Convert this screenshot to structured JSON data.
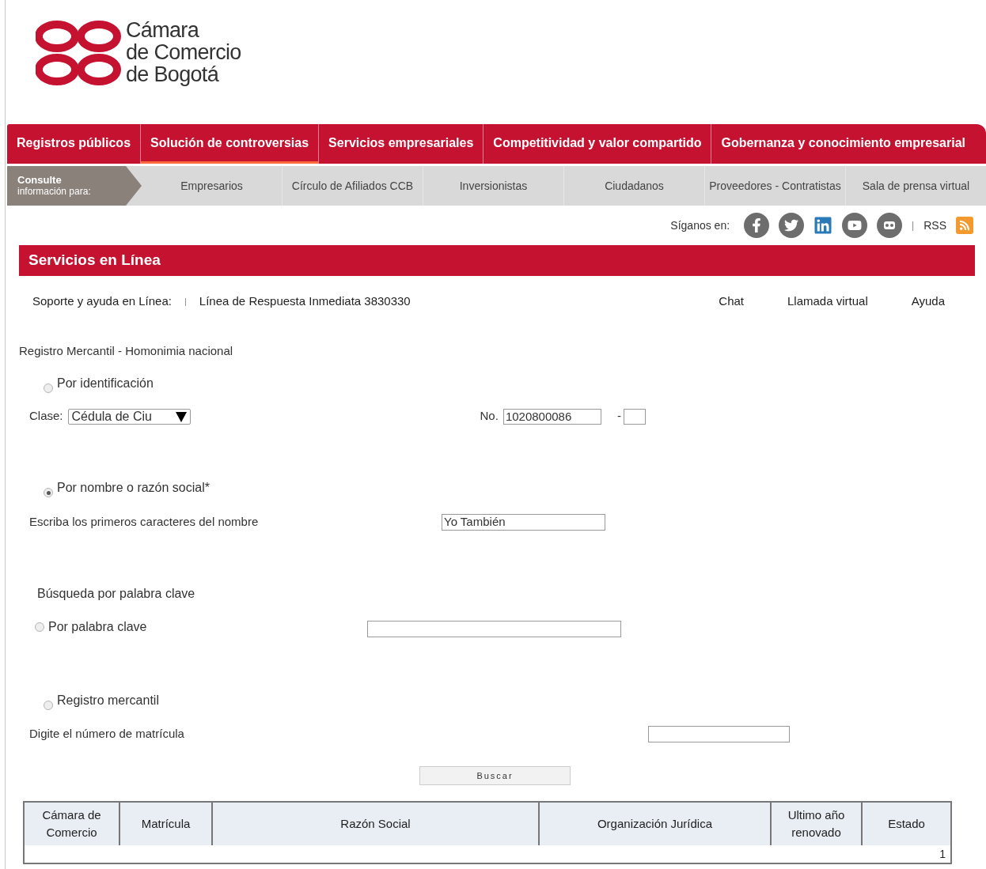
{
  "logo": {
    "lines": [
      "Cámara",
      "de Comercio",
      "de Bogotá"
    ]
  },
  "main_nav": [
    {
      "label": "Registros públicos",
      "selected": false
    },
    {
      "label": "Solución de controversias",
      "selected": true
    },
    {
      "label": "Servicios empresariales",
      "selected": false
    },
    {
      "label": "Competitividad y valor compartido",
      "selected": false
    },
    {
      "label": "Gobernanza y conocimiento empresarial",
      "selected": false
    }
  ],
  "sub_nav": {
    "title": "Consulte",
    "subtitle": "información para:",
    "items": [
      "Empresarios",
      "Círculo de Afiliados CCB",
      "Inversionistas",
      "Ciudadanos",
      "Proveedores - Contratistas",
      "Sala de prensa virtual"
    ]
  },
  "social": {
    "label": "Síganos en:",
    "separator": "|",
    "rss": "RSS"
  },
  "section_title": "Servicios en Línea",
  "support": {
    "label": "Soporte y ayuda en Línea:",
    "separator": "|",
    "line": "Línea de Respuesta Inmediata 3830330",
    "links": [
      "Chat",
      "Llamada virtual",
      "Ayuda"
    ]
  },
  "form": {
    "title": "Registro Mercantil - Homonimia nacional",
    "by_id": {
      "label": "Por identificación",
      "selected": false,
      "class_label": "Clase:",
      "class_value": "Cédula de Ciu",
      "number_label": "No.",
      "number_value": "1020800086",
      "dash": "-"
    },
    "by_name": {
      "label": "Por nombre o razón social*",
      "selected": true,
      "prompt": "Escriba los primeros caracteres del nombre",
      "value": "Yo También"
    },
    "keyword_heading": "Búsqueda por palabra clave",
    "by_keyword": {
      "label": "Por palabra clave",
      "selected": false
    },
    "by_registry": {
      "label": "Registro mercantil",
      "selected": false,
      "prompt": "Digite el número de matrícula"
    },
    "submit": "Buscar"
  },
  "table": {
    "columns": [
      "Cámara de Comercio",
      "Matrícula",
      "Razón Social",
      "Organización Jurídica",
      "Ultimo año renovado",
      "Estado"
    ],
    "pager": "1"
  }
}
